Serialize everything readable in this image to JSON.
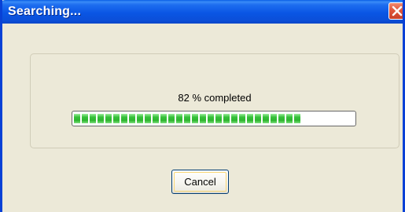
{
  "window": {
    "title": "Searching...",
    "close_icon": "close-icon"
  },
  "progress": {
    "status_text": "82 % completed",
    "percent": 82,
    "fill_color": "#36c03a"
  },
  "buttons": {
    "cancel_label": "Cancel"
  },
  "colors": {
    "titlebar": "#0a56e4",
    "dialog_bg": "#ece9d8",
    "close_button": "#e0563b"
  }
}
